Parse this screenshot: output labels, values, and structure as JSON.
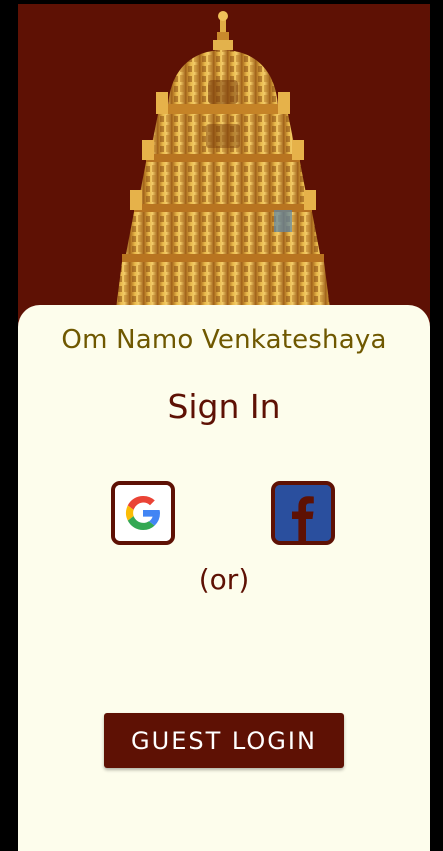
{
  "header": {
    "greeting": "Om Namo Venkateshaya"
  },
  "signin": {
    "title": "Sign In",
    "google_icon": "google-logo",
    "facebook_icon": "facebook-logo",
    "separator": "(or)"
  },
  "guest": {
    "label": "GUEST LOGIN"
  },
  "colors": {
    "background": "#5e1104",
    "card": "#fdfdec",
    "greeting_text": "#6f5800",
    "accent": "#5e1104",
    "gold": "#d9a53a"
  }
}
